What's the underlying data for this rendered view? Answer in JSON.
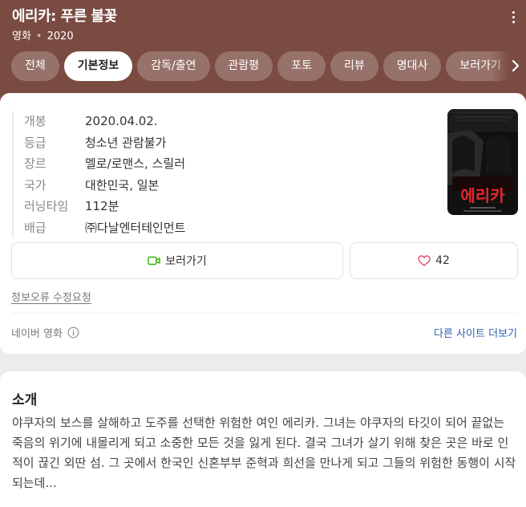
{
  "header": {
    "title": "에리카: 푸른 불꽃",
    "category": "영화",
    "year": "2020",
    "bg_color": "#7a4b41"
  },
  "tabs": [
    {
      "label": "전체",
      "active": false
    },
    {
      "label": "기본정보",
      "active": true
    },
    {
      "label": "감독/출연",
      "active": false
    },
    {
      "label": "관람평",
      "active": false
    },
    {
      "label": "포토",
      "active": false
    },
    {
      "label": "리뷰",
      "active": false
    },
    {
      "label": "명대사",
      "active": false
    },
    {
      "label": "보러가기",
      "active": false
    }
  ],
  "info": [
    {
      "key": "개봉",
      "value": "2020.04.02."
    },
    {
      "key": "등급",
      "value": "청소년 관람불가"
    },
    {
      "key": "장르",
      "value": "멜로/로맨스, 스릴러"
    },
    {
      "key": "국가",
      "value": "대한민국, 일본"
    },
    {
      "key": "러닝타임",
      "value": "112분"
    },
    {
      "key": "배급",
      "value": "㈜다날엔터테인먼트"
    }
  ],
  "poster": {
    "title_text": "에리카"
  },
  "actions": {
    "watch_label": "보러가기",
    "like_count": "42",
    "watch_icon_color": "#2db400",
    "like_icon_color": "#e84a5f"
  },
  "report_label": "정보오류 수정요청",
  "source_label": "네이버 영화",
  "more_sites_label": "다른 사이트 더보기",
  "intro": {
    "title": "소개",
    "text": "야쿠자의 보스를 살해하고 도주를 선택한 위험한 여인 에리카. 그녀는 야쿠자의 타깃이 되어 끝없는 죽음의 위기에 내몰리게 되고 소중한 모든 것을 잃게 된다. 결국 그녀가 살기 위해 찾은 곳은 바로 인적이 끊긴 외딴 섬. 그 곳에서 한국인 신혼부부 준혁과 희선을 만나게 되고 그들의 위험한 동행이 시작되는데..."
  }
}
